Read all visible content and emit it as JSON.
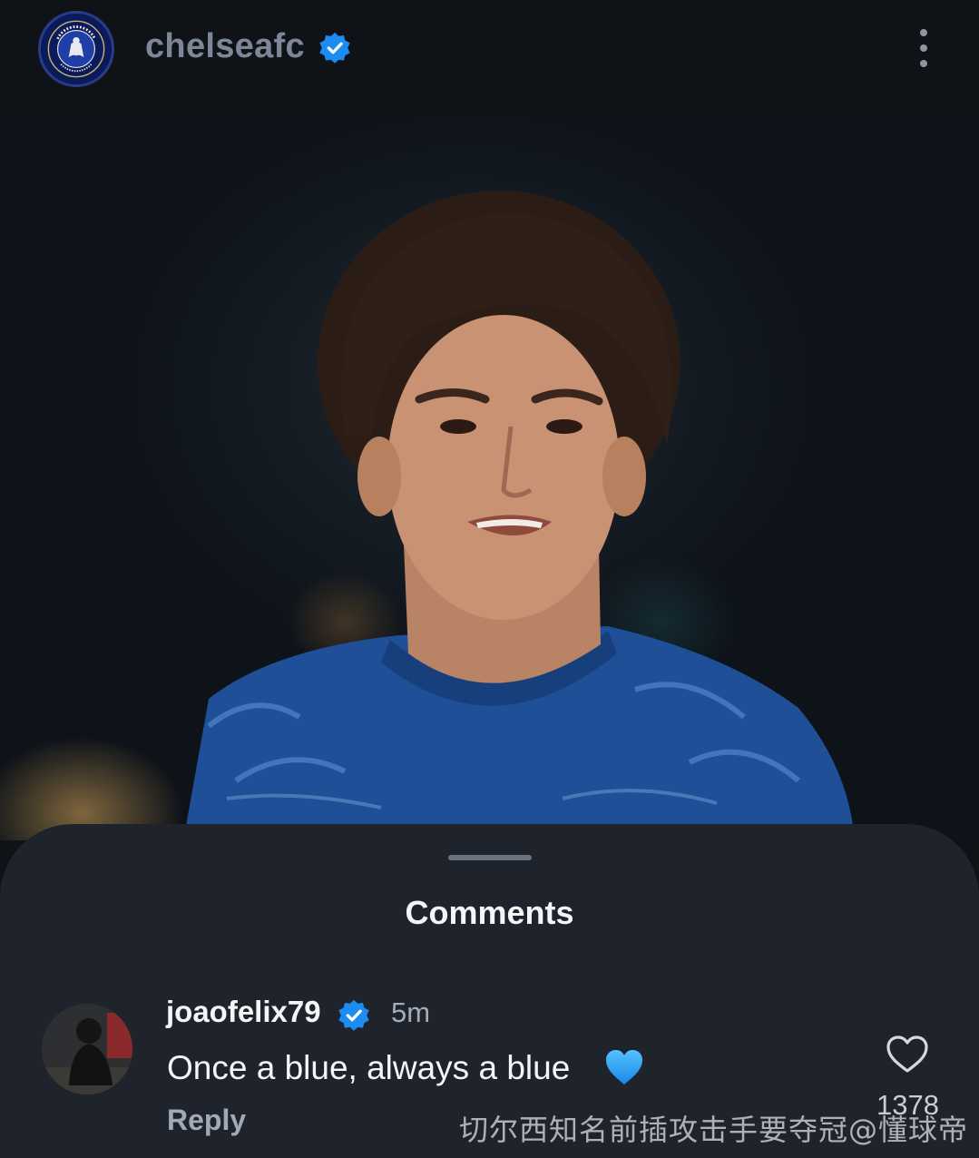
{
  "header": {
    "username": "chelseafc",
    "verified": true,
    "avatar_logo_text": "CHELSEA FOOTBALL CLUB"
  },
  "post": {
    "image_description_icon": "player-photo"
  },
  "comments_sheet": {
    "title": "Comments",
    "comments": [
      {
        "username": "joaofelix79",
        "verified": true,
        "time": "5m",
        "text": "Once a blue, always a blue",
        "emoji": "blue-heart",
        "reply_label": "Reply",
        "likes": "1378"
      }
    ]
  },
  "watermark": "切尔西知名前插攻击手要夺冠@懂球帝",
  "colors": {
    "verified_blue": "#1d8cf0",
    "background": "#0f1217",
    "sheet": "#1f242c",
    "heart_blue": "#29a5ff"
  }
}
